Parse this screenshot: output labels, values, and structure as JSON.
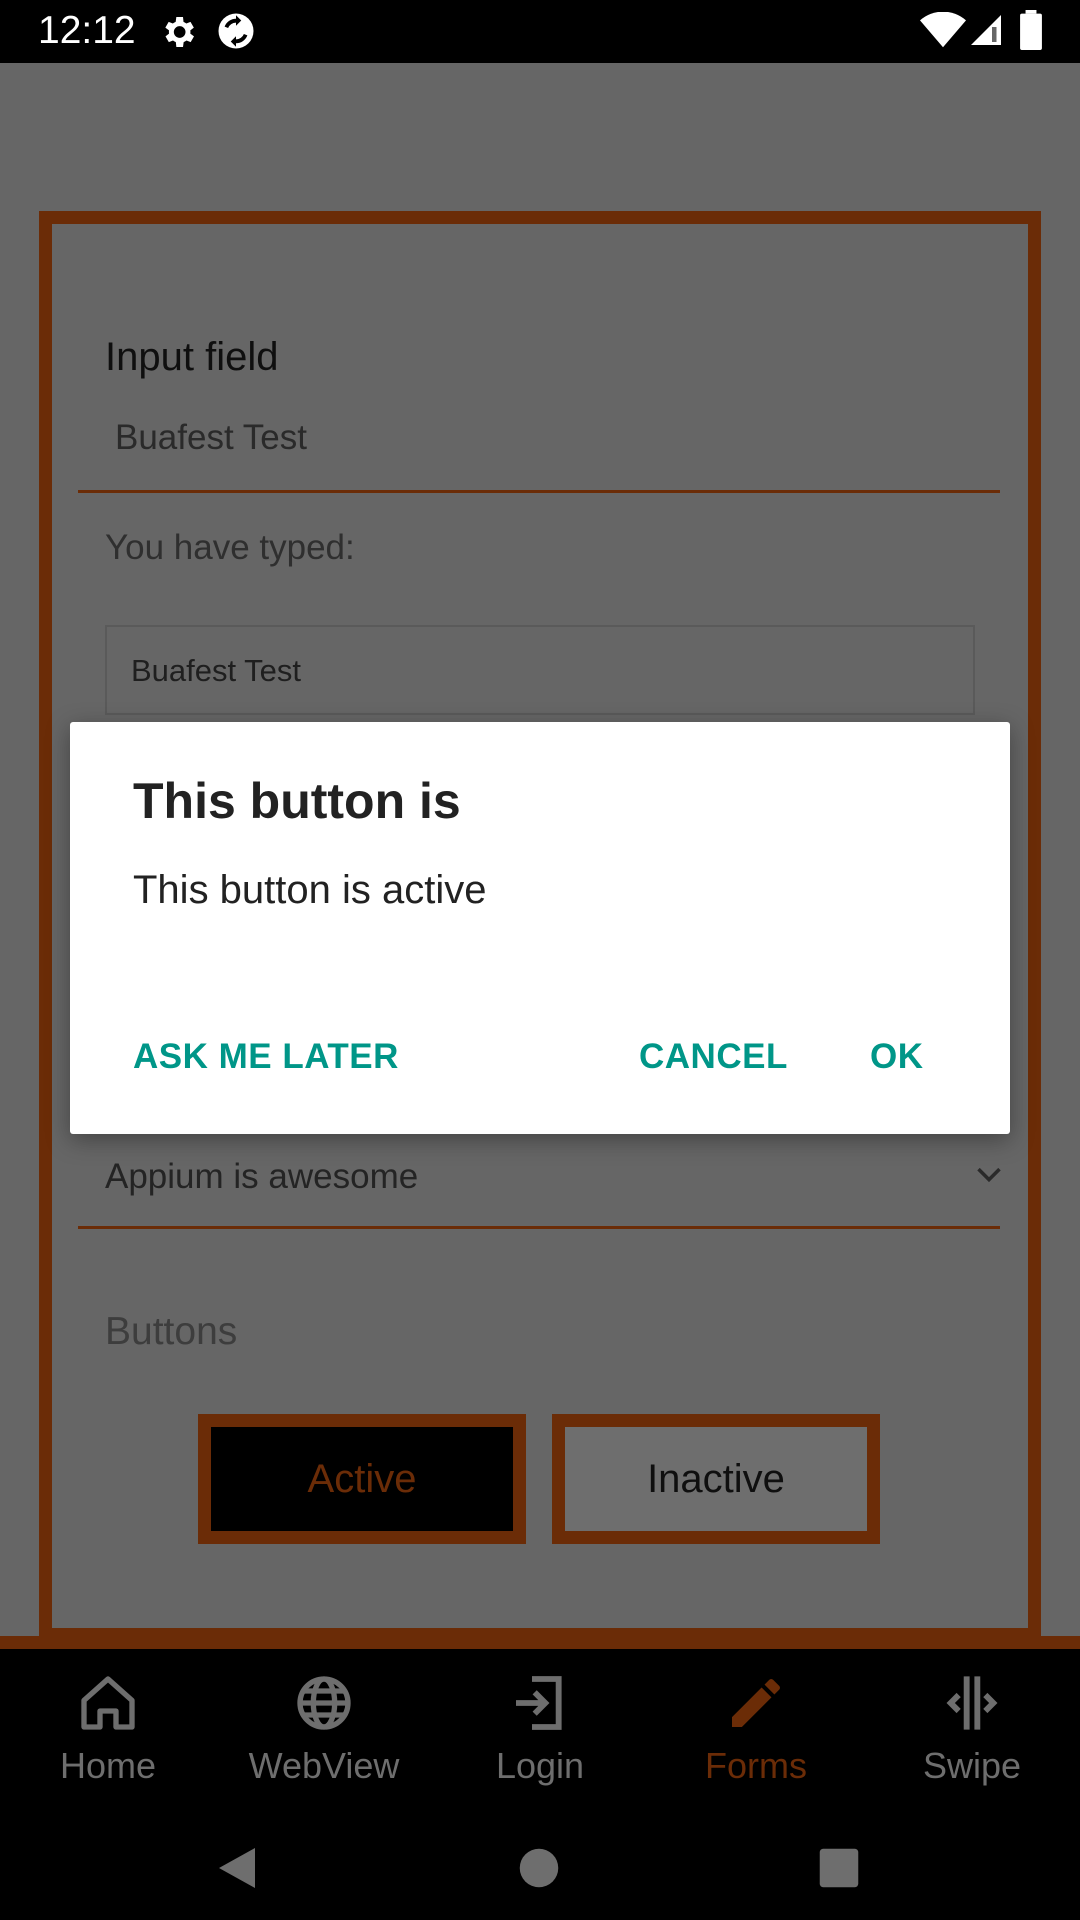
{
  "status_bar": {
    "time": "12:12",
    "icons": [
      "gear-icon",
      "sync-icon",
      "wifi-icon",
      "signal-icon",
      "battery-icon"
    ]
  },
  "form": {
    "input_label": "Input field",
    "input_value": "Buafest Test",
    "typed_label": "You have typed:",
    "typed_value": "Buafest Test",
    "dropdown_value": "Appium is awesome",
    "buttons_label": "Buttons",
    "active_button": "Active",
    "inactive_button": "Inactive"
  },
  "dialog": {
    "title": "This button is",
    "message": "This button is active",
    "ask_later": "ASK ME LATER",
    "cancel": "CANCEL",
    "ok": "OK"
  },
  "bottom_nav": {
    "items": [
      {
        "label": "Home",
        "icon": "home-icon"
      },
      {
        "label": "WebView",
        "icon": "globe-icon"
      },
      {
        "label": "Login",
        "icon": "login-icon"
      },
      {
        "label": "Forms",
        "icon": "pencil-icon",
        "active": true
      },
      {
        "label": "Swipe",
        "icon": "swipe-icon"
      }
    ]
  },
  "colors": {
    "accent": "#6b2c07",
    "dialog_button": "#009688",
    "scrim_background": "#666666"
  }
}
